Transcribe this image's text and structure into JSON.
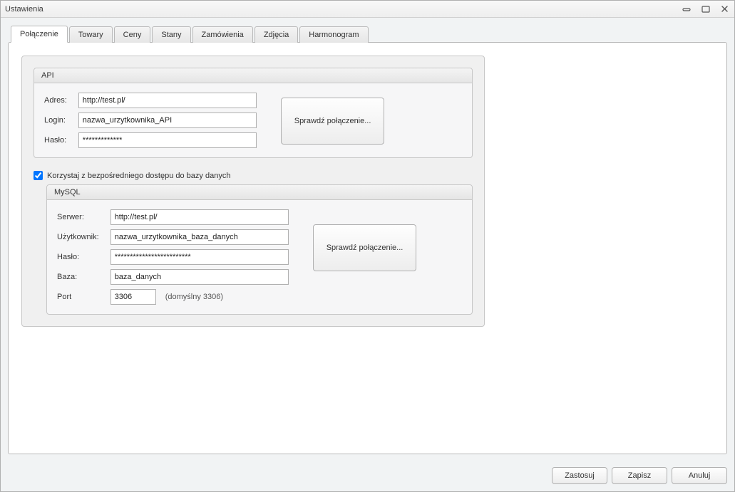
{
  "window": {
    "title": "Ustawienia"
  },
  "tabs": [
    {
      "label": "Połączenie"
    },
    {
      "label": "Towary"
    },
    {
      "label": "Ceny"
    },
    {
      "label": "Stany"
    },
    {
      "label": "Zamówienia"
    },
    {
      "label": "Zdjęcia"
    },
    {
      "label": "Harmonogram"
    }
  ],
  "api": {
    "group_label": "API",
    "address_label": "Adres:",
    "address_value": "http://test.pl/",
    "login_label": "Login:",
    "login_value": "nazwa_urzytkownika_API",
    "password_label": "Hasło:",
    "password_value": "*************",
    "check_button": "Sprawdź połączenie..."
  },
  "db_checkbox_label": "Korzystaj z bezpośredniego dostępu do bazy danych",
  "mysql": {
    "group_label": "MySQL",
    "server_label": "Serwer:",
    "server_value": "http://test.pl/",
    "user_label": "Użytkownik:",
    "user_value": "nazwa_urzytkownika_baza_danych",
    "password_label": "Hasło:",
    "password_value": "*************************",
    "database_label": "Baza:",
    "database_value": "baza_danych",
    "port_label": "Port",
    "port_value": "3306",
    "port_hint": "(domyślny 3306)",
    "check_button": "Sprawdź połączenie..."
  },
  "footer": {
    "apply": "Zastosuj",
    "save": "Zapisz",
    "cancel": "Anuluj"
  }
}
